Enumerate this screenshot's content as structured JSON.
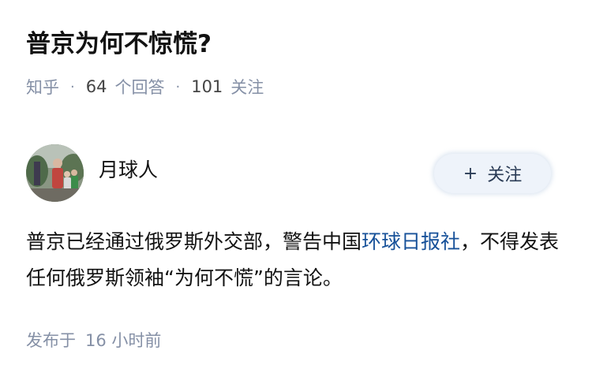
{
  "question": {
    "title": "普京为何不惊慌?"
  },
  "meta": {
    "source": "知乎",
    "separator": "·",
    "answers_count": "64",
    "answers_label": "个回答",
    "followers_count": "101",
    "followers_label": "关注"
  },
  "author": {
    "name": "月球人",
    "follow_plus": "+",
    "follow_label": "关注"
  },
  "answer": {
    "text_part1": "普京已经通过俄罗斯外交部，警告中国",
    "link_text": "环球日报社",
    "text_part2": "，不得发表任何俄罗斯领袖“为何不慌”的言论。"
  },
  "footer": {
    "published_label": "发布于",
    "time_ago": "16 小时前"
  },
  "colors": {
    "link": "#175199",
    "meta": "#8590a6",
    "follow_bg": "#eef3fa"
  }
}
